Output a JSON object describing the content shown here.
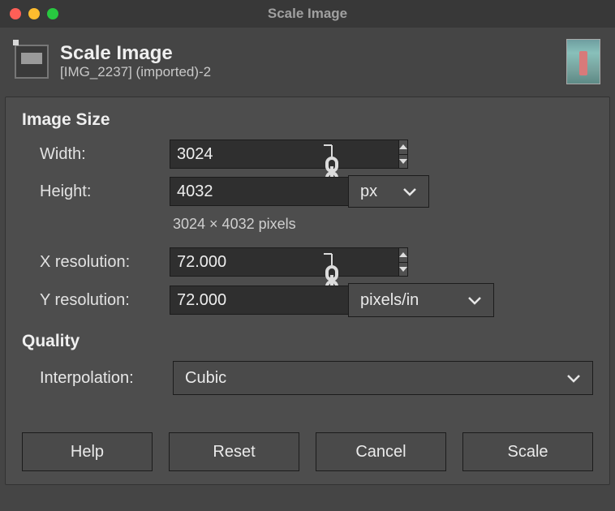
{
  "window": {
    "title": "Scale Image"
  },
  "header": {
    "title": "Scale Image",
    "subtitle": "[IMG_2237] (imported)-2"
  },
  "sections": {
    "image_size": {
      "heading": "Image Size",
      "width_label": "Width:",
      "width_value": "3024",
      "height_label": "Height:",
      "height_value": "4032",
      "unit_selected": "px",
      "info_text": "3024 × 4032 pixels",
      "xres_label": "X resolution:",
      "xres_value": "72.000",
      "yres_label": "Y resolution:",
      "yres_value": "72.000",
      "res_unit_selected": "pixels/in"
    },
    "quality": {
      "heading": "Quality",
      "interp_label": "Interpolation:",
      "interp_selected": "Cubic"
    }
  },
  "buttons": {
    "help": "Help",
    "reset": "Reset",
    "cancel": "Cancel",
    "scale": "Scale"
  }
}
